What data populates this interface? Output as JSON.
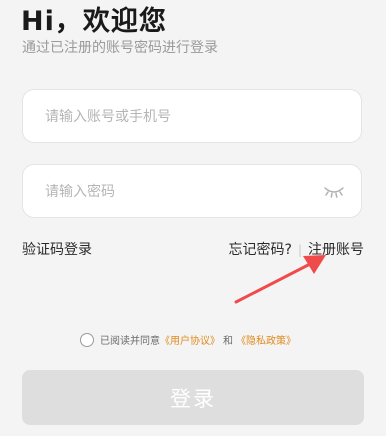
{
  "header": {
    "greeting": "Hi，欢迎您",
    "subtitle": "通过已注册的账号密码进行登录"
  },
  "form": {
    "account_placeholder": "请输入账号或手机号",
    "password_placeholder": "请输入密码",
    "password_toggle_icon": "eye-closed-icon"
  },
  "links": {
    "sms_login": "验证码登录",
    "forgot_password": "忘记密码?",
    "separator": "|",
    "register": "注册账号"
  },
  "agreement": {
    "prefix": "已阅读并同意",
    "user_agreement": "《用户协议》",
    "and": "和",
    "privacy_policy": "《隐私政策》",
    "checked": false
  },
  "login_button": "登录",
  "colors": {
    "background": "#f4f4f5",
    "link_accent": "#e08a1b",
    "annotation_arrow": "#f04b4b",
    "button_disabled": "#dedede"
  }
}
